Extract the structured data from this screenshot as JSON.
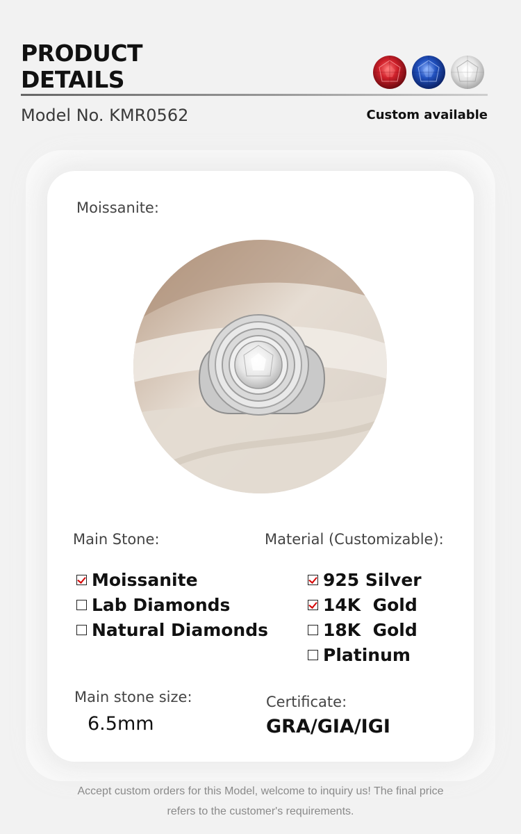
{
  "header": {
    "title_line1": "PRODUCT",
    "title_line2": "DETAILS",
    "model": "Model No. KMR0562",
    "custom": "Custom available",
    "gem_icons": [
      "red-gem-icon",
      "blue-gem-icon",
      "white-gem-icon"
    ],
    "gem_colors": [
      "#c8202a",
      "#1f4fb8",
      "#e8e8e8"
    ]
  },
  "card": {
    "stone_type_label": "Moissanite:",
    "main_stone_label": "Main Stone:",
    "main_stone_options": [
      {
        "label": "Moissanite",
        "checked": true
      },
      {
        "label": "Lab Diamonds",
        "checked": false
      },
      {
        "label": "Natural Diamonds",
        "checked": false
      }
    ],
    "material_label": "Material (Customizable):",
    "material_options": [
      {
        "label": "925 Silver",
        "checked": true
      },
      {
        "label": "14K  Gold",
        "checked": true
      },
      {
        "label": "18K  Gold",
        "checked": false
      },
      {
        "label": "Platinum",
        "checked": false
      }
    ],
    "size_label": "Main stone size:",
    "size_value": "6.5mm",
    "certificate_label": "Certificate:",
    "certificate_value": "GRA/GIA/IGI"
  },
  "footer": {
    "line1": "Accept custom orders for this Model, welcome to inquiry us! The final price",
    "line2": "refers to the customer's requirements."
  }
}
